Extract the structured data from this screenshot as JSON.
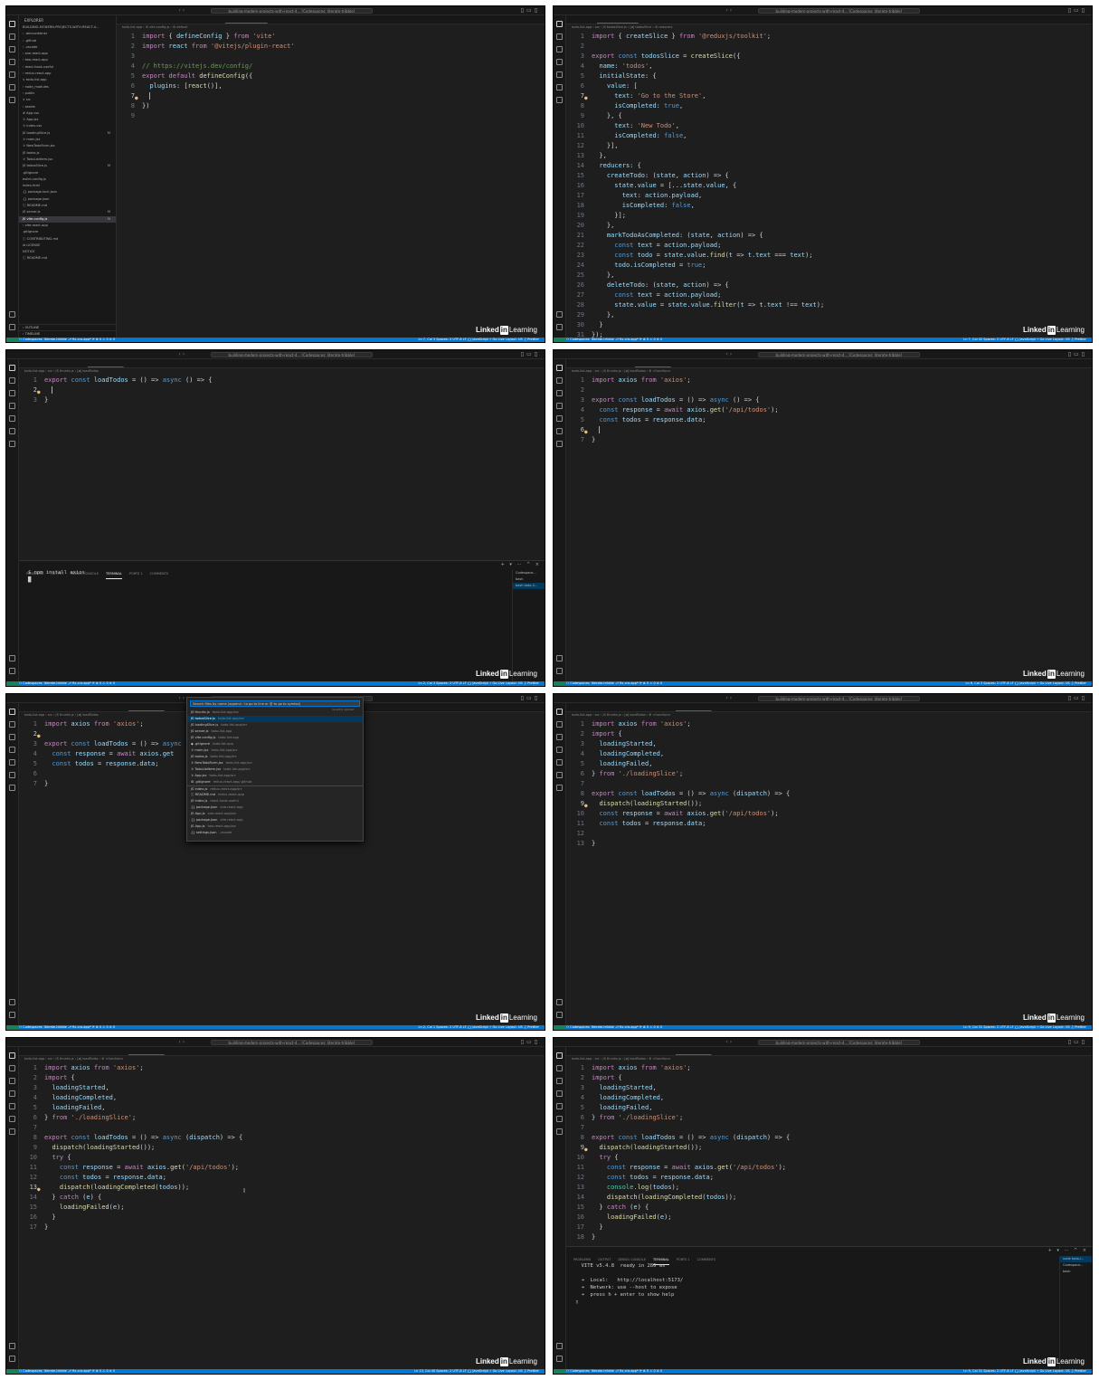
{
  "brand": {
    "name_1": "Linked",
    "name_in": "in",
    "name_2": "Learning"
  },
  "titlebar_text": "building-modern-projects-with-react-4... [Codespaces: literate-tribble]",
  "tiles": [
    {
      "explorer": {
        "header": "EXPLORER",
        "items": [
          "BUILDING-MODERN-PROJECTS-WITH-REACT-4...",
          "› .devcontainer",
          "› .github",
          "› .vscode",
          "› one-react-app",
          "› two-react-app",
          "› react-hook-useful",
          "› redux-react-app",
          "∨ todo-list-app",
          "  › node_modules",
          "  › public",
          "  ∨ src",
          "    › assets",
          "    # App.css",
          "    ⚛ App.jsx",
          "    ⚛ index.css",
          "    JS loadingSlice.js",
          "    ⚛ main.jsx",
          "    ⚛ NewTodoForm.jsx",
          "    JS todos.js",
          "    ⚛ TodoListItem.jsx",
          "    JS todosSlice.js",
          "  .gitignore",
          "  eslint.config.js",
          "  index.html",
          "  {} package-lock.json",
          "  {} package.json",
          "  ⓘ README.md",
          "  JS server.js",
          "  JS vite.config.js",
          "› vite-react-app",
          "  .gitignore",
          "  ⓘ CONTRIBUTING.md",
          "  ⚖ LICENSE",
          "  NOTICE",
          "  ⓘ README.md"
        ],
        "footer_outline": "› OUTLINE",
        "footer_timeline": "› TIMELINE"
      },
      "tabs": [
        "todos.js",
        "todosSlice.js",
        "loadingSlice.js",
        "vite.config.js",
        "server.js"
      ],
      "active_tab": 3,
      "breadcrumb": "todo-list-app › ⚙ vite.config.js › ⚙ default",
      "lines": [
        "import { defineConfig } from 'vite'",
        "import react from '@vitejs/plugin-react'",
        "",
        "// https://vitejs.dev/config/",
        "export default defineConfig({",
        "  plugins: [react()],",
        "  |",
        "})",
        ""
      ],
      "cursor_line": 7,
      "status_left": "⚇ Codespaces: literate-tribble   ⎇ fix-cra-app* ⟳   ⊗ 0 ⚠ 0   ⊘ 0",
      "status_right": "Ln 7, Col 3   Spaces: 2   UTF-8   LF   {} JavaScript   ⚡ Go Live   Layout: US   ♫ Prettier"
    },
    {
      "tabs": [
        "main.jsx",
        "todosSlice.js",
        "loadingSlice.js"
      ],
      "active_tab": 1,
      "breadcrumb": "todo-list-app › src › JS todosSlice.js › [ø] todosSlice › ⚙ reducers",
      "lines": [
        "import { createSlice } from '@reduxjs/toolkit';",
        "",
        "export const todosSlice = createSlice({",
        "  name: 'todos',",
        "  initialState: {",
        "    value: [",
        "      text: 'Go to the Store',",
        "      isCompleted: true,",
        "    }, {",
        "      text: 'New Todo',",
        "      isCompleted: false,",
        "    }],",
        "  },",
        "  reducers: {",
        "    createTodo: (state, action) => {",
        "      state.value = [...state.value, {",
        "        text: action.payload,",
        "        isCompleted: false,",
        "      }];",
        "    },",
        "    markTodoAsCompleted: (state, action) => {",
        "      const text = action.payload;",
        "      const todo = state.value.find(t => t.text === text);",
        "      todo.isCompleted = true;",
        "    },",
        "    deleteTodo: (state, action) => {",
        "      const text = action.payload;",
        "      state.value = state.value.filter(t => t.text !== text);",
        "    },",
        "  }",
        "});"
      ],
      "cursor_line": 7,
      "status_left": "⚇ Codespaces: literate-tribble   ⎇ fix-cra-app* ⟳   ⊗ 0 ⚠ 0   ⊘ 0",
      "status_right": "Ln 7, Col 42   Spaces: 2   UTF-8   LF   {} JavaScript   ⚡ Go Live   Layout: US   ♫ Prettier"
    },
    {
      "tabs": [
        "main.jsx",
        "todosSlice.js",
        "thunks.js",
        "loadingSlice.js"
      ],
      "active_tab": 2,
      "breadcrumb": "todo-list-app › src › JS thunks.js › [ø] loadTodos",
      "lines": [
        "export const loadTodos = () => async () => {",
        "  |",
        "}"
      ],
      "cursor_line": 2,
      "panel": {
        "tabs": [
          "PROBLEMS",
          "OUTPUT",
          "DEBUG CONSOLE",
          "TERMINAL",
          "PORTS",
          "COMMENTS"
        ],
        "active": 3,
        "ports_badge": "1",
        "lines": [
          "$ npm install axios",
          "█"
        ],
        "side": [
          "Codespace...",
          "bash",
          "bash todo-li..."
        ],
        "side_selected": 2
      },
      "status_left": "⚇ Codespaces: literate-tribble   ⎇ fix-cra-app* ⟳   ⊗ 0 ⚠ 0   ⊘ 0",
      "status_right": "Ln 2, Col 3   Spaces: 2   UTF-8   LF   {} JavaScript   ⚡ Go Live   Layout: US   ♫ Prettier"
    },
    {
      "tabs": [
        "main.jsx",
        "todosSlice.js",
        "thunks.js",
        "server.js",
        "loadingSlice.js"
      ],
      "active_tab": 2,
      "breadcrumb": "todo-list-app › src › JS thunks.js › [ø] loadTodos › ⚙ <function>",
      "lines": [
        "import axios from 'axios';",
        "",
        "export const loadTodos = () => async () => {",
        "  const response = await axios.get('/api/todos');",
        "  const todos = response.data;",
        "  |",
        "}"
      ],
      "cursor_line": 6,
      "status_left": "⚇ Codespaces: literate-tribble   ⎇ fix-cra-app* ⟳   ⊗ 0 ⚠ 0   ⊘ 0",
      "status_right": "Ln 6, Col 3   Spaces: 2   UTF-8   LF   {} JavaScript   ⚡ Go Live   Layout: US   ♫ Prettier"
    },
    {
      "tabs": [
        "main.jsx",
        "todosSlice.js",
        "loadingSlice.js",
        "thunks.js"
      ],
      "active_tab": 3,
      "breadcrumb": "todo-list-app › src › JS thunks.js › [ø] loadTodos",
      "lines": [
        "import axios from 'axios';",
        "",
        "export const loadTodos = () => async",
        "  const response = await axios.get",
        "  const todos = response.data;",
        "",
        "}"
      ],
      "cursor_line": 2,
      "quickopen": {
        "placeholder": "Search files by name (append : to go to line or @ to go to symbol)",
        "recent_label": "recently opened",
        "items": [
          {
            "name": "JS thunks.js",
            "path": "todo-list-app/src"
          },
          {
            "name": "JS todosSlice.js",
            "path": "todo-list-app/src"
          },
          {
            "name": "JS loadingSlice.js",
            "path": "todo-list-app/src"
          },
          {
            "name": "JS server.js",
            "path": "todo-list-app"
          },
          {
            "name": "JS vite.config.js",
            "path": "todo-list-app"
          },
          {
            "name": "◆ .gitignore",
            "path": "todo-list-app"
          },
          {
            "name": "⚛ main.jsx",
            "path": "todo-list-app/src"
          },
          {
            "name": "JS todos.js",
            "path": "todo-list-app/src"
          },
          {
            "name": "⚛ NewTodoForm.jsx",
            "path": "todo-list-app/src"
          },
          {
            "name": "⚛ TodoListItem.jsx",
            "path": "todo-list-app/src"
          },
          {
            "name": "⚛ App.jsx",
            "path": "todo-list-app/src"
          },
          {
            "name": "⚙ .gitignore",
            "path": "redux-react-app/.github"
          },
          {
            "name": "JS index.js",
            "path": "redux-react-app/src"
          },
          {
            "name": "ⓘ README.md",
            "path": "redux-react-app"
          },
          {
            "name": "JS index.js",
            "path": "react-hook-useful"
          },
          {
            "name": "{} package.json",
            "path": "one-react-app"
          },
          {
            "name": "JS App.js",
            "path": "one-react-app/src"
          },
          {
            "name": "{} package.json",
            "path": "vite-react-app"
          },
          {
            "name": "JS App.js",
            "path": "two-react-app/src"
          },
          {
            "name": "{} settings.json",
            "path": ".vscode"
          }
        ],
        "separator_after": 12
      },
      "status_left": "⚇ Codespaces: literate-tribble   ⎇ fix-cra-app* ⟳   ⊗ 0 ⚠ 0   ⊘ 0",
      "status_right": "Ln 2, Col 1   Spaces: 2   UTF-8   LF   {} JavaScript   ⚡ Go Live   Layout: US   ♫ Prettier"
    },
    {
      "tabs": [
        "main.jsx",
        "todosSlice.js",
        "loadingSlice.js",
        "thunks.js",
        "server.js"
      ],
      "active_tab": 3,
      "breadcrumb": "todo-list-app › src › JS thunks.js › [ø] loadTodos › ⚙ <function>",
      "lines": [
        "import axios from 'axios';",
        "import {",
        "  loadingStarted,",
        "  loadingCompleted,",
        "  loadingFailed,",
        "} from './loadingSlice';",
        "",
        "export const loadTodos = () => async (dispatch) => {",
        "  dispatch(loadingStarted());",
        "  const response = await axios.get('/api/todos');",
        "  const todos = response.data;",
        "",
        "}"
      ],
      "cursor_line": 9,
      "status_left": "⚇ Codespaces: literate-tribble   ⎇ fix-cra-app* ⟳   ⊗ 0 ⚠ 0   ⊘ 0",
      "status_right": "Ln 9, Col 31   Spaces: 2   UTF-8   LF   {} JavaScript   ⚡ Go Live   Layout: US   ♫ Prettier"
    },
    {
      "tabs": [
        "main.jsx",
        "todosSlice.js",
        "loadingSlice.js",
        "thunks.js",
        "Todos (slice.js)",
        "server.js"
      ],
      "active_tab": 3,
      "breadcrumb": "todo-list-app › src › JS thunks.js › [ø] loadTodos › ⚙ <function>",
      "lines": [
        "import axios from 'axios';",
        "import {",
        "  loadingStarted,",
        "  loadingCompleted,",
        "  loadingFailed,",
        "} from './loadingSlice';",
        "",
        "export const loadTodos = () => async (dispatch) => {",
        "  dispatch(loadingStarted());",
        "  try {",
        "    const response = await axios.get('/api/todos');",
        "    const todos = response.data;",
        "    dispatch(loadingCompleted(todos));",
        "  } catch (e) {",
        "    loadingFailed(e);",
        "  }",
        "}"
      ],
      "cursor_line": 13,
      "status_left": "⚇ Codespaces: literate-tribble   ⎇ fix-cra-app* ⟳   ⊗ 0 ⚠ 0   ⊘ 0",
      "status_right": "Ln 13, Col 40   Spaces: 2   UTF-8   LF   {} JavaScript   ⚡ Go Live   Layout: US   ♫ Prettier"
    },
    {
      "tabs": [
        "main.jsx",
        "todosSlice.js",
        "loadingSlice.js",
        "thunks.js",
        "Todos (slice.js)"
      ],
      "active_tab": 3,
      "breadcrumb": "todo-list-app › src › JS thunks.js › [ø] loadTodos › ⚙ <function>",
      "lines": [
        "import axios from 'axios';",
        "import {",
        "  loadingStarted,",
        "  loadingCompleted,",
        "  loadingFailed,",
        "} from './loadingSlice';",
        "",
        "export const loadTodos = () => async (dispatch) => {",
        "  dispatch(loadingStarted());",
        "  try {",
        "    const response = await axios.get('/api/todos');",
        "    const todos = response.data;",
        "    console.log(todos);",
        "    dispatch(loadingCompleted(todos));",
        "  } catch (e) {",
        "    loadingFailed(e);",
        "  }",
        "}"
      ],
      "cursor_line": 9,
      "panel": {
        "tabs": [
          "PROBLEMS",
          "OUTPUT",
          "DEBUG CONSOLE",
          "TERMINAL",
          "PORTS",
          "COMMENTS"
        ],
        "active": 3,
        "ports_badge": "1",
        "lines": [
          "",
          "  VITE v5.4.8  ready in 286 ms",
          "",
          "  ➜  Local:   http://localhost:5173/",
          "  ➜  Network: use --host to expose",
          "  ➜  press h + enter to show help",
          "▯"
        ],
        "side": [
          "node todo-l...",
          "Codespace...",
          "bash"
        ],
        "side_selected": 0
      },
      "status_left": "⚇ Codespaces: literate-tribble   ⎇ fix-cra-app* ⟳   ⊗ 0 ⚠ 0   ⊘ 0",
      "status_right": "Ln 9, Col 31   Spaces: 2   UTF-8   LF   {} JavaScript   ⚡ Go Live   Layout: US   ♫ Prettier"
    }
  ]
}
